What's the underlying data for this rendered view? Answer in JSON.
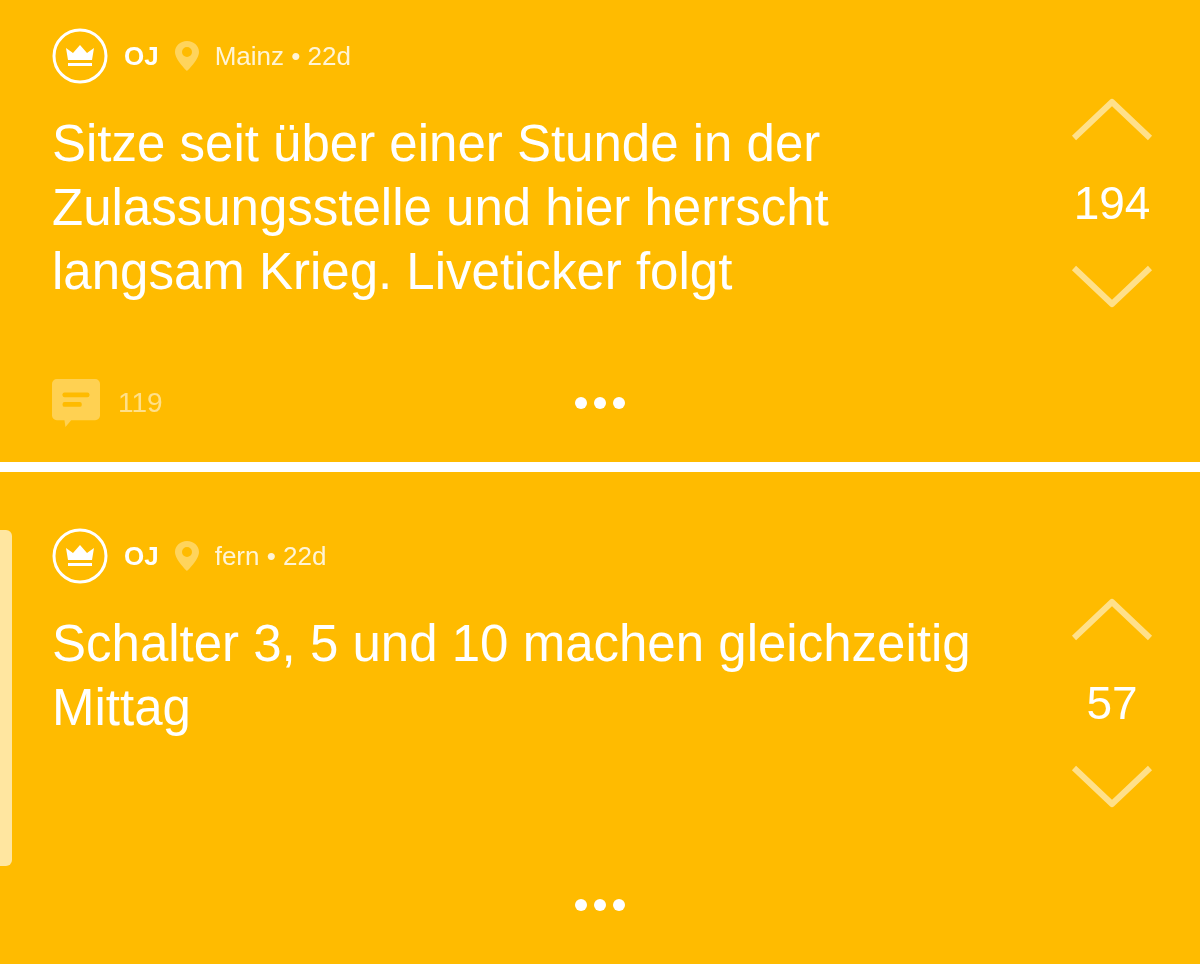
{
  "posts": [
    {
      "author": "OJ",
      "meta": "Mainz • 22d",
      "text": "Sitze seit über einer Stunde in der Zulassungsstelle und hier herrscht langsam Krieg. Liveticker folgt",
      "votes": "194",
      "comments": "119",
      "highlighted": false
    },
    {
      "author": "OJ",
      "meta": "fern • 22d",
      "text": "Schalter 3, 5 und 10 machen gleichzeitig Mittag",
      "votes": "57",
      "highlighted": true
    }
  ]
}
